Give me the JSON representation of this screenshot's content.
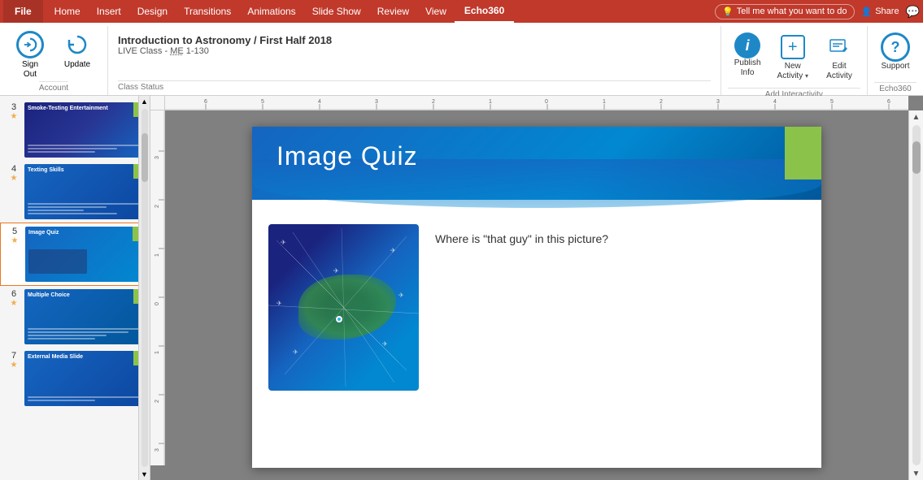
{
  "menubar": {
    "file": "File",
    "home": "Home",
    "insert": "Insert",
    "design": "Design",
    "transitions": "Transitions",
    "animations": "Animations",
    "slideshow": "Slide Show",
    "review": "Review",
    "view": "View",
    "echo360": "Echo360",
    "tell_me": "Tell me what you want to do",
    "share": "Share"
  },
  "account": {
    "sign_out_label": "Sign\nOut",
    "update_label": "Update"
  },
  "class_status": {
    "title": "Introduction to Astronomy / First Half 2018",
    "subtitle": "LIVE Class - ME 1-130",
    "section_label": "Class Status",
    "me_text": "ME"
  },
  "add_interactivity": {
    "publish_info_label": "Publish\nInfo",
    "new_activity_label": "New\nActivity",
    "edit_activity_label": "Edit\nActivity",
    "section_label": "Add Interactivity"
  },
  "echo360_section": {
    "support_label": "Support",
    "section_label": "Echo360"
  },
  "slides": [
    {
      "number": "3",
      "starred": true,
      "label": "Smoke-Testing Entertainment",
      "thumb_class": "slide-thumb-3"
    },
    {
      "number": "4",
      "starred": true,
      "label": "Texting Skills",
      "thumb_class": "slide-thumb-4"
    },
    {
      "number": "5",
      "starred": true,
      "label": "Image Quiz",
      "thumb_class": "slide-thumb-5",
      "active": true
    },
    {
      "number": "6",
      "starred": true,
      "label": "Multiple Choice",
      "thumb_class": "slide-thumb-6"
    },
    {
      "number": "7",
      "starred": true,
      "label": "External Media Slide",
      "thumb_class": "slide-thumb-7"
    }
  ],
  "slide_content": {
    "title": "Image Quiz",
    "question": "Where is \"that guy\" in this picture?"
  }
}
